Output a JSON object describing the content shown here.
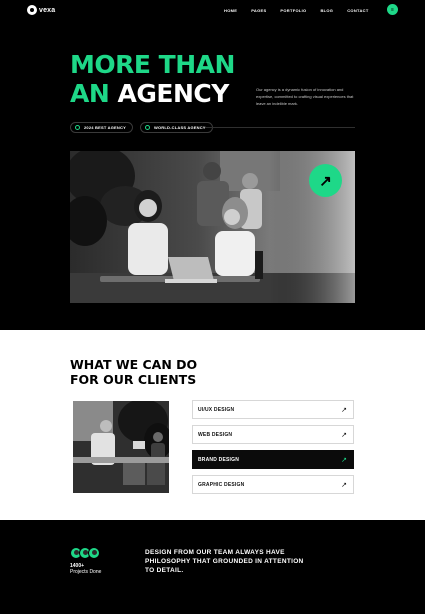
{
  "brand": {
    "name": "vexa",
    "accent": "#1ed888"
  },
  "nav": {
    "items": [
      "HOME",
      "PAGES",
      "PORTFOLIO",
      "BLOG",
      "CONTACT"
    ]
  },
  "hero": {
    "headline_line1": "MORE THAN",
    "headline_an": "AN",
    "headline_agency": "AGENCY",
    "intro": "Our agency is a dynamic fusion of innovation and expertise, committed to crafting visual experiences that leave an indelible mark.",
    "badges": [
      "2024 BEST AGENCY",
      "WORLD-CLASS AGENCY"
    ],
    "arrow_icon": "arrow-up-right-icon"
  },
  "services": {
    "title_line1": "WHAT WE CAN DO",
    "title_line2": "FOR OUR CLIENTS",
    "items": [
      {
        "label": "UI/UX DESIGN",
        "active": false
      },
      {
        "label": "WEB DESIGN",
        "active": false
      },
      {
        "label": "BRAND DESIGN",
        "active": true
      },
      {
        "label": "GRAPHIC DESIGN",
        "active": false
      }
    ]
  },
  "footer": {
    "projects_count": "1400+",
    "projects_label": "Projects Done",
    "philosophy": "DESIGN FROM OUR TEAM ALWAYS HAVE PHILOSOPHY THAT GROUNDED IN ATTENTION TO DETAIL."
  }
}
